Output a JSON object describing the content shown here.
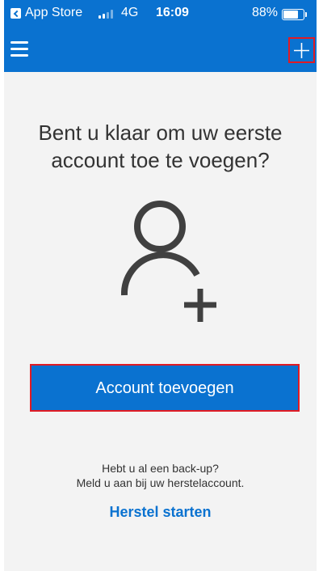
{
  "status_bar": {
    "back_app": "App Store",
    "network": "4G",
    "time": "16:09",
    "battery_percent": "88%",
    "battery_level": 0.88
  },
  "header": {
    "menu_icon": "hamburger-icon",
    "add_icon": "plus-icon",
    "background_color": "#0a72d0"
  },
  "empty_state": {
    "headline_line1": "Bent u klaar om uw eerste",
    "headline_line2": "account toe te voegen?",
    "illustration_icon": "add-person-icon",
    "add_account_label": "Account toevoegen",
    "backup_question": "Hebt u al een back-up?",
    "backup_hint": "Meld u aan bij uw herstelaccount.",
    "restore_link": "Herstel starten"
  },
  "colors": {
    "accent": "#0a72d0",
    "highlight_outline": "#e01b24",
    "content_background": "#f3f3f3",
    "text": "#333333"
  }
}
